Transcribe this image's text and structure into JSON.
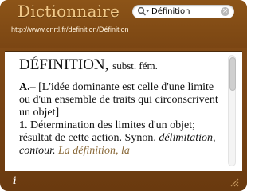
{
  "widget": {
    "title": "Dictionnaire",
    "url": "http://www.cnrtl.fr/definition/Définition"
  },
  "search": {
    "value": "Définition",
    "clear_glyph": "×",
    "icon": "search-icon"
  },
  "entry": {
    "headword": "DÉFINITION,",
    "pos": "subst. fém.",
    "section_marker": "A.–",
    "section_text": "[L'idée dominante est celle d'une limite ou d'un ensemble de traits qui circonscrivent un objet]",
    "sense_number": "1.",
    "sense_text": "Détermination des limites d'un objet; résultat de cette action. Synon.",
    "synonyms": "délimitation, contour.",
    "example": "La définition, la"
  },
  "footer": {
    "info_glyph": "i",
    "resize_icon": "resize-grip-icon"
  },
  "scroll": {
    "thumb_fraction": 0.3
  },
  "colors": {
    "frame": "#7b4613",
    "title": "#f1c98a",
    "example": "#8a6a3a"
  }
}
